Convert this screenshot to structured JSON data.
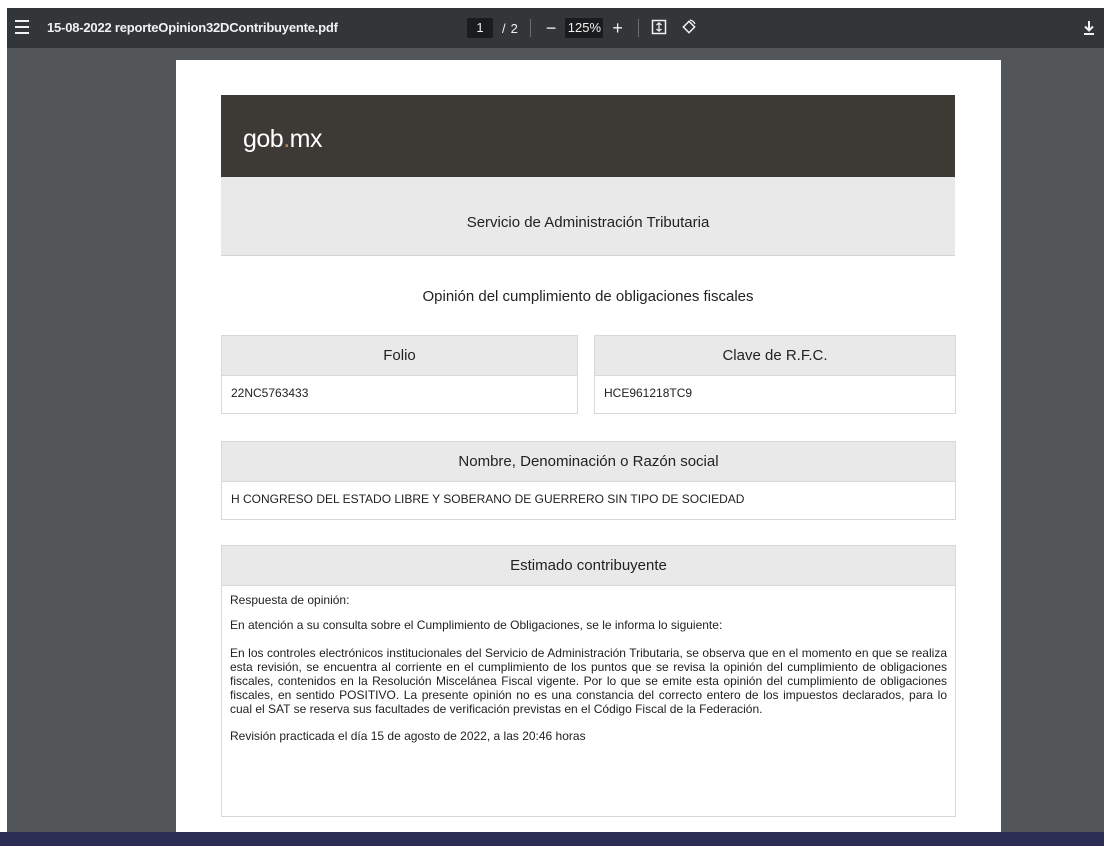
{
  "viewer": {
    "file_name": "15-08-2022 reporteOpinion32DContribuyente.pdf",
    "current_page": "1",
    "page_sep": "/",
    "total_pages": "2",
    "zoom_minus": "−",
    "zoom_level": "125%",
    "zoom_plus": "+",
    "icons": [
      "menu-icon",
      "fit-page-icon",
      "rotate-icon",
      "download-icon"
    ]
  },
  "document": {
    "logo_left": "gob",
    "logo_dot": ".",
    "logo_right": "mx",
    "agency": "Servicio de Administración Tributaria",
    "title": "Opinión del cumplimiento de obligaciones fiscales",
    "folio_label": "Folio",
    "folio_value": "22NC5763433",
    "rfc_label": "Clave de R.F.C.",
    "rfc_value": "HCE961218TC9",
    "name_label": "Nombre, Denominación o Razón social",
    "name_value": "H CONGRESO DEL ESTADO LIBRE Y SOBERANO DE GUERRERO SIN TIPO DE SOCIEDAD",
    "message_label": "Estimado contribuyente",
    "message": {
      "line1": "Respuesta de opinión:",
      "line2": "En atención a su consulta sobre el Cumplimiento de Obligaciones, se le informa lo siguiente:",
      "paragraph": "En los controles electrónicos institucionales del Servicio de Administración Tributaria, se observa que en el momento en que se realiza esta revisión, se encuentra al corriente en el cumplimiento de los puntos que se revisa la opinión del cumplimiento de obligaciones fiscales, contenidos en la Resolución Miscelánea Fiscal vigente. Por lo que se emite esta opinión del cumplimiento de obligaciones fiscales, en sentido POSITIVO. La presente opinión no es una constancia del correcto entero de los impuestos declarados, para lo cual el SAT se reserva sus facultades de verificación previstas en el Código Fiscal de la Federación.",
      "review": "Revisión practicada el día 15 de agosto de 2022, a las 20:46 horas"
    }
  },
  "colors": {
    "toolbar": "#323639",
    "viewer_bg": "#525659",
    "gov_header": "#3d3a35",
    "logo_dot": "#b38e5d",
    "section_bg": "#e9e9e9"
  }
}
